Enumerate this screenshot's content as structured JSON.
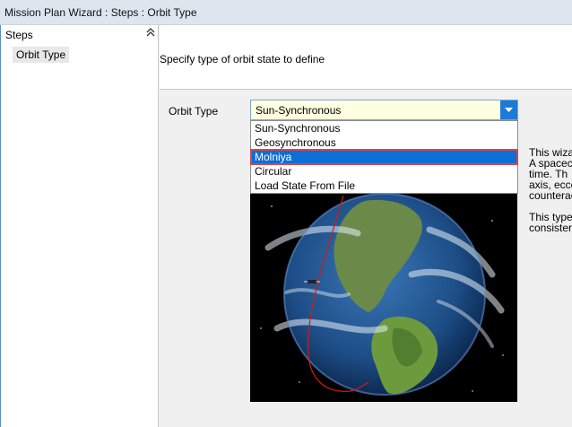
{
  "window": {
    "title": "Mission Plan Wizard : Steps : Orbit Type"
  },
  "sidebar": {
    "header": "Steps",
    "collapse_icon": "chevron-double-up-icon",
    "items": [
      {
        "label": "Orbit Type"
      }
    ]
  },
  "header": {
    "instruction": "Specify type of orbit state to define"
  },
  "form": {
    "orbit_type_label": "Orbit Type",
    "selected_value": "Sun-Synchronous",
    "options": [
      {
        "label": "Sun-Synchronous"
      },
      {
        "label": "Geosynchronous"
      },
      {
        "label": "Molniya"
      },
      {
        "label": "Circular"
      },
      {
        "label": "Load State From File"
      }
    ],
    "highlighted_option": "Molniya"
  },
  "description": {
    "lines": [
      "This wiza",
      "A spacec",
      "time.  Th",
      "axis, ecce",
      "counterac"
    ],
    "lines2": [
      "This type",
      "consister"
    ]
  },
  "colors": {
    "accent": "#1c7bd6",
    "highlight_border": "#d9434a",
    "orbit": "#d11a1a"
  }
}
